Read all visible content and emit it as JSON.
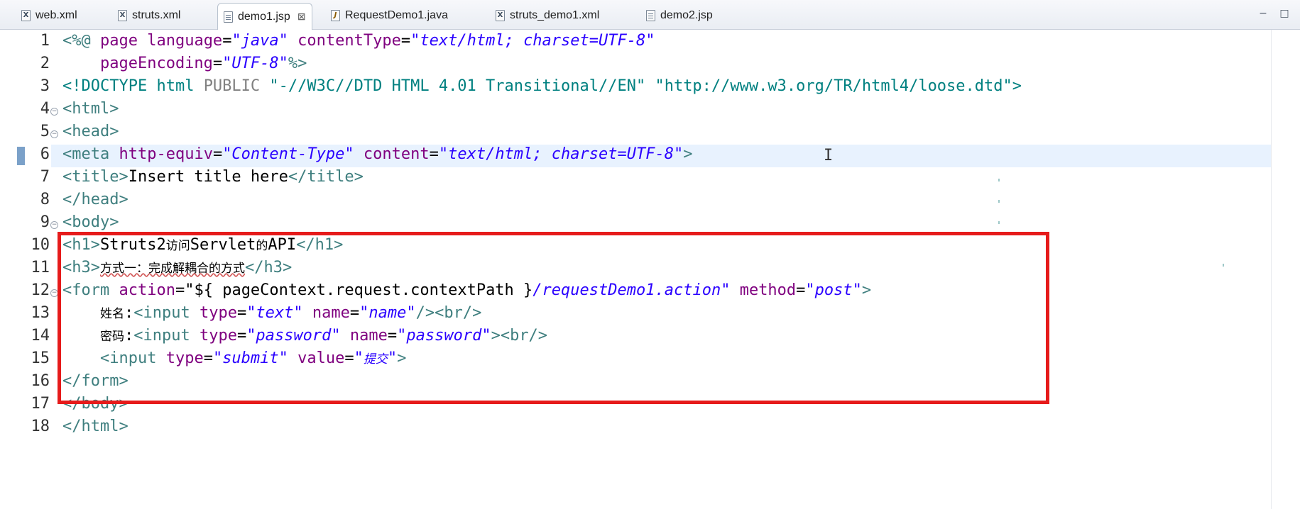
{
  "tabs": [
    {
      "label": "web.xml",
      "icon": "xml-file-icon",
      "active": false
    },
    {
      "label": "struts.xml",
      "icon": "xml-file-icon",
      "active": false
    },
    {
      "label": "demo1.jsp",
      "icon": "jsp-file-icon",
      "active": true,
      "close": "⊠"
    },
    {
      "label": "RequestDemo1.java",
      "icon": "java-file-icon",
      "active": false
    },
    {
      "label": "struts_demo1.xml",
      "icon": "xml-file-icon",
      "active": false
    },
    {
      "label": "demo2.jsp",
      "icon": "jsp-file-icon",
      "active": false
    }
  ],
  "window_controls": {
    "minimize": "−",
    "maximize": "□"
  },
  "editor": {
    "line_numbers": [
      "1",
      "2",
      "3",
      "4",
      "5",
      "6",
      "7",
      "8",
      "9",
      "10",
      "11",
      "12",
      "13",
      "14",
      "15",
      "16",
      "17",
      "18"
    ],
    "current_line": 6,
    "lines": {
      "l1": {
        "a": "<%@ ",
        "b": "page ",
        "c": "language",
        "d": "=",
        "e": "\"java\"",
        "f": " contentType",
        "g": "=",
        "h": "\"text/html; charset=UTF-8\""
      },
      "l2": {
        "a": "    pageEncoding",
        "b": "=",
        "c": "\"UTF-8\"",
        "d": "%>"
      },
      "l3": {
        "a": "<!DOCTYPE ",
        "b": "html ",
        "c": "PUBLIC ",
        "d": "\"-//W3C//DTD HTML 4.01 Transitional//EN\" \"http://www.w3.org/TR/html4/loose.dtd\"",
        "e": ">"
      },
      "l4": {
        "a": "<html>"
      },
      "l5": {
        "a": "<head>"
      },
      "l6": {
        "a": "<meta ",
        "b": "http-equiv",
        "c": "=",
        "d": "\"Content-Type\"",
        "e": " content",
        "f": "=",
        "g": "\"text/html; charset=UTF-8\"",
        "h": ">"
      },
      "l7": {
        "a": "<title>",
        "b": "Insert title here",
        "c": "</title>"
      },
      "l8": {
        "a": "</head>"
      },
      "l9": {
        "a": "<body>"
      },
      "l10": {
        "a": "<h1>",
        "b": "Struts2",
        "c": "访问",
        "d": "Servlet",
        "e": "的",
        "f": "API",
        "g": "</h1>"
      },
      "l11": {
        "a": "<h3>",
        "b": "方式一：完成解耦合的方式",
        "c": "</h3>"
      },
      "l12": {
        "a": "<form ",
        "b": "action",
        "c": "=",
        "d": "\"${ pageContext.request.contextPath }",
        "e": "/requestDemo1.action\"",
        "f": " method",
        "g": "=",
        "h": "\"post\"",
        "i": ">"
      },
      "l13": {
        "a": "    ",
        "b": "姓名",
        "c": ":",
        "d": "<input ",
        "e": "type",
        "f": "=",
        "g": "\"text\"",
        "h": " name",
        "i": "=",
        "j": "\"name\"",
        "k": "/><br/>"
      },
      "l14": {
        "a": "    ",
        "b": "密码",
        "c": ":",
        "d": "<input ",
        "e": "type",
        "f": "=",
        "g": "\"password\"",
        "h": " name",
        "i": "=",
        "j": "\"password\"",
        "k": "><br/>"
      },
      "l15": {
        "a": "    ",
        "b": "<input ",
        "c": "type",
        "d": "=",
        "e": "\"submit\"",
        "f": " value",
        "g": "=",
        "h": "\"",
        "i": "提交",
        "j": "\"",
        "k": ">"
      },
      "l16": {
        "a": "</form>"
      },
      "l17": {
        "a": "</body>"
      },
      "l18": {
        "a": "</html>"
      }
    }
  },
  "colors": {
    "tag": "#3f7f7f",
    "attribute": "#7f007f",
    "attribute_value": "#2a00ff",
    "highlight_box": "#e61b1b",
    "current_line": "#e8f2fe"
  }
}
